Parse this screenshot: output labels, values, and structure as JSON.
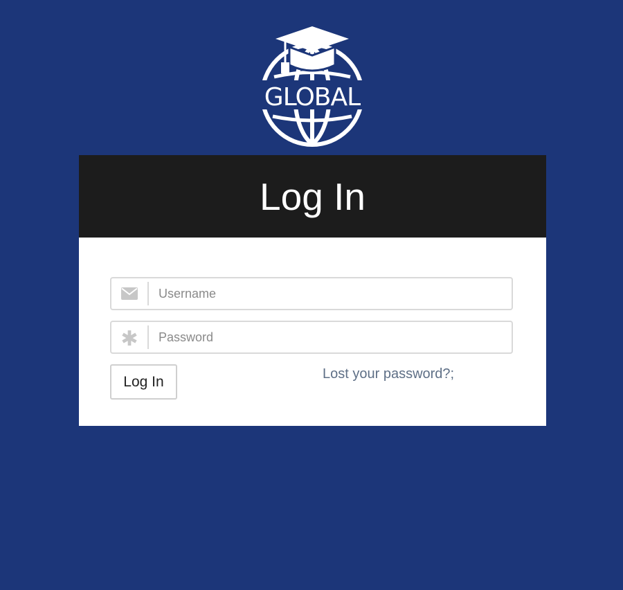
{
  "logo": {
    "text": "GLOBAL",
    "icon": "globe-graduation-cap-icon",
    "color": "#ffffff"
  },
  "header": {
    "title": "Log In"
  },
  "form": {
    "username": {
      "placeholder": "Username",
      "value": "",
      "icon": "envelope-icon"
    },
    "password": {
      "placeholder": "Password",
      "value": "",
      "icon": "asterisk-icon"
    },
    "submit_label": "Log In",
    "lost_password_label": "Lost your password?;"
  },
  "colors": {
    "page_background": "#1c3679",
    "header_background": "#1c1c1c",
    "card_background": "#ffffff",
    "link": "#5e6f86",
    "icon": "#c7c7c7"
  }
}
